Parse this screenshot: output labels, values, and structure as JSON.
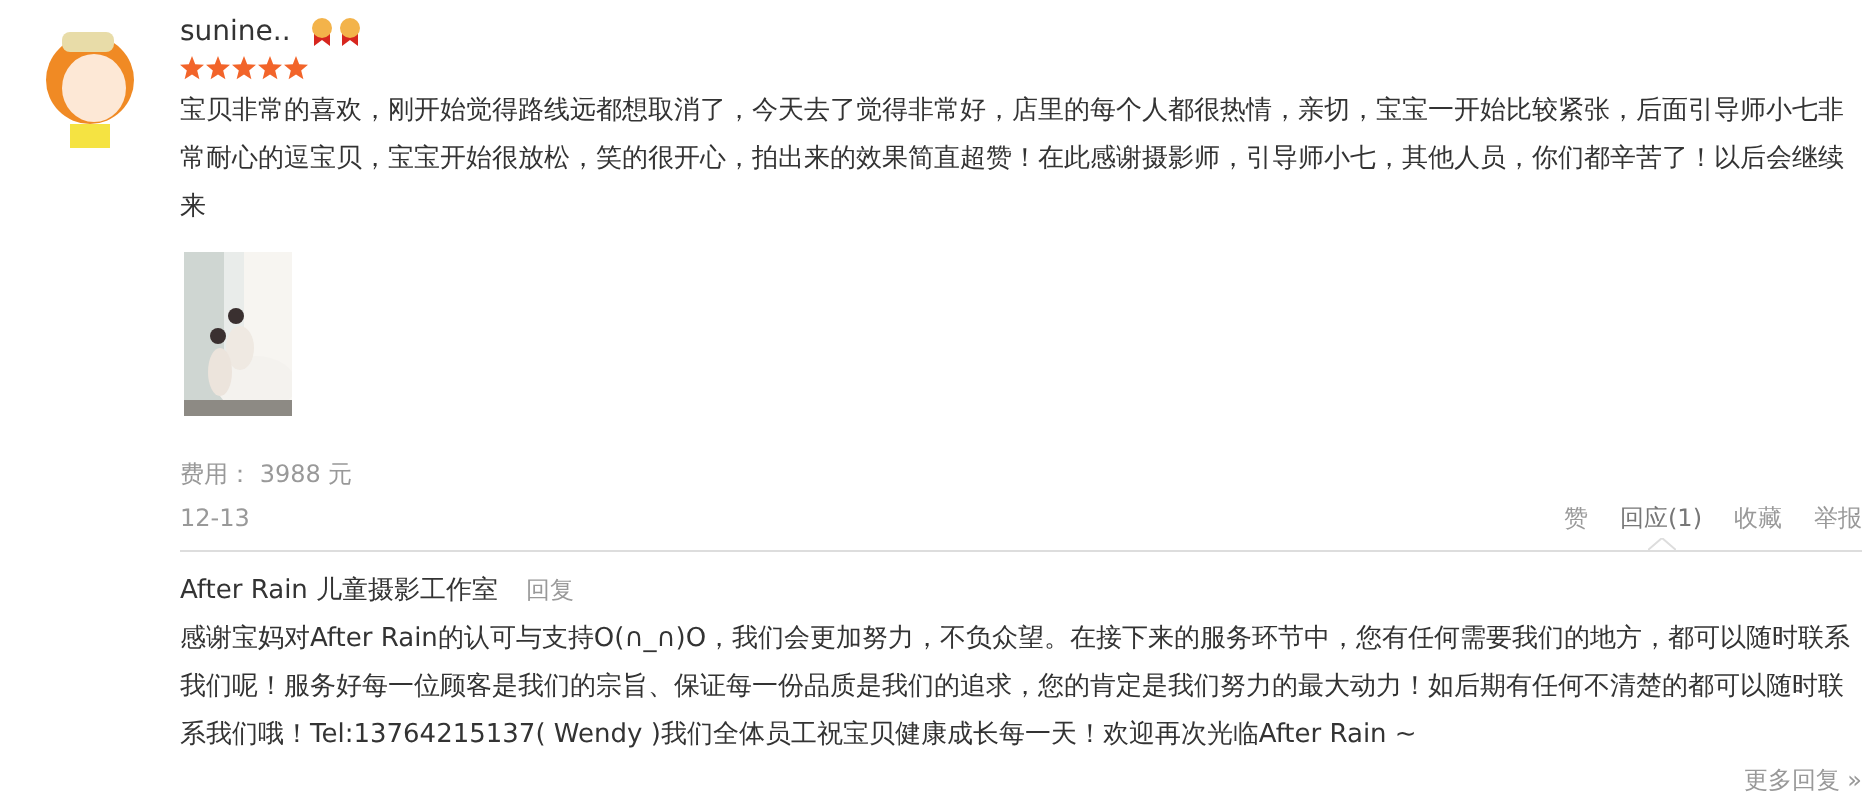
{
  "review": {
    "user": "sunine..",
    "stars": 5,
    "text": "宝贝非常的喜欢，刚开始觉得路线远都想取消了，今天去了觉得非常好，店里的每个人都很热情，亲切，宝宝一开始比较紧张，后面引导师小七非常耐心的逗宝贝，宝宝开始很放松，笑的很开心，拍出来的效果简直超赞！在此感谢摄影师，引导师小七，其他人员，你们都辛苦了！以后会继续来",
    "photos": [
      {
        "kind": "picture"
      }
    ],
    "cost": "费用： 3988 元",
    "date": "12-13",
    "actions": [
      {
        "label": "赞",
        "selected": false
      },
      {
        "label": "回应(1)",
        "selected": true
      },
      {
        "label": "收藏",
        "selected": false
      },
      {
        "label": "举报",
        "selected": false
      }
    ]
  },
  "reply": {
    "author": "After Rain 儿童摄影工作室",
    "reply_link": "回复",
    "text": "感谢宝妈对After Rain的认可与支持O(∩_∩)O，我们会更加努力，不负众望。在接下来的服务环节中，您有任何需要我们的地方，都可以随时联系我们呢！服务好每一位顾客是我们的宗旨、保证每一份品质是我们的追求，您的肯定是我们努力的最大动力！如后期有任何不清楚的都可以随时联系我们哦！Tel:13764215137( Wendy )我们全体员工祝宝贝健康成长每一天！欢迎再次光临After Rain ~"
  },
  "more_replies": "更多回复 »"
}
